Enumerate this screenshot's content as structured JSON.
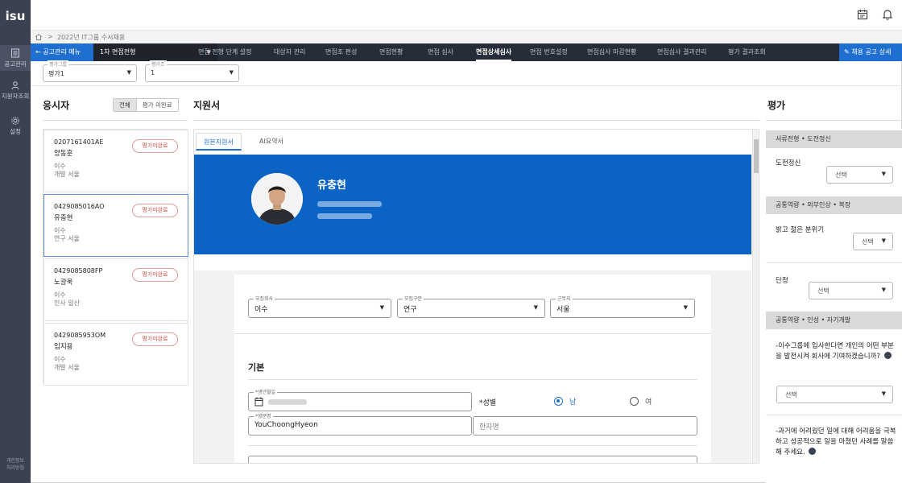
{
  "brand": {
    "logo": "isu"
  },
  "rail": {
    "items": [
      {
        "label": "공고관리",
        "icon": "document-icon"
      },
      {
        "label": "지원자조회",
        "icon": "person-icon"
      },
      {
        "label": "설정",
        "icon": "gear-icon"
      }
    ],
    "footer_line1": "개인정보",
    "footer_line2": "처리방침"
  },
  "breadcrumb": {
    "home_icon": "home-icon",
    "separator": ">",
    "current": "2022년 IT그룹 수시채용"
  },
  "nav": {
    "back_label": "← 공고관리 메뉴",
    "stage_select": "1차 면접전형",
    "tabs": [
      {
        "label": "면접 전형 단계 설정"
      },
      {
        "label": "대상자 관리"
      },
      {
        "label": "면접조 편성"
      },
      {
        "label": "면접현황"
      },
      {
        "label": "면접 심사"
      },
      {
        "label": "면접상세심사"
      },
      {
        "label": "면접 번호설정"
      },
      {
        "label": "면접심사 마감현황"
      },
      {
        "label": "면접심사 결과관리"
      },
      {
        "label": "평가 결과조회"
      }
    ],
    "active_tab": "면접상세심사",
    "cta_label": "채용 공고 상세"
  },
  "filters": [
    {
      "label": "평가그룹",
      "value": "평가1"
    },
    {
      "label": "평가조",
      "value": "1"
    }
  ],
  "applicants": {
    "title": "응시자",
    "seg_all": "전체",
    "seg_incomplete": "평가 미완료",
    "list": [
      {
        "id": "0207161401AE",
        "name": "양동훈",
        "company": "이수",
        "dept": "개발 서울",
        "status": "평가미완료"
      },
      {
        "id": "0429085016AO",
        "name": "유충현",
        "company": "이수",
        "dept": "연구 서울",
        "status": "평가미완료"
      },
      {
        "id": "0429085808FP",
        "name": "노광욱",
        "company": "이수",
        "dept": "인사 일산",
        "status": "평가미완료"
      },
      {
        "id": "0429085953OM",
        "name": "임지용",
        "company": "이수",
        "dept": "개발 서울",
        "status": "평가미완료"
      }
    ]
  },
  "application": {
    "title": "지원서",
    "tabs": [
      "원본지원서",
      "AI요약서"
    ],
    "profile_name": "유충현",
    "fields": {
      "company": {
        "label": "모집회사",
        "value": "이수"
      },
      "category": {
        "label": "모집구분",
        "value": "연구"
      },
      "location": {
        "label": "근무지",
        "value": "서울"
      }
    },
    "section_basic": "기본",
    "birth_label": "*생년월일",
    "gender_label": "*성별",
    "gender_male": "남",
    "gender_female": "여",
    "english_name_label": "*영문명",
    "english_name_value": "YouChoongHyeon",
    "hanja_placeholder": "한자명"
  },
  "evaluation": {
    "title": "평가",
    "sections": [
      {
        "header": "서류전형 • 도전정신",
        "items": [
          {
            "label": "도전정신",
            "value": "선택"
          }
        ]
      },
      {
        "header": "공통역량 • 외부인상 • 복장",
        "items": [
          {
            "label": "밝고 젊은 분위기",
            "value": "선택"
          },
          {
            "label": "단정",
            "value": "선택"
          }
        ]
      },
      {
        "header": "공통역량 • 인성 • 자기개발",
        "items": [
          {
            "label": "-이수그룹에 입사한다면 개인의 어떤 부분을 발전시켜 회사에 기여하겠습니까?",
            "value": "선택"
          },
          {
            "label": "-과거에 어려웠던 일에 대해 어려움을 극복하고 성공적으로 일을 마쳤던 사례를 말씀해 주세요.",
            "value": ""
          }
        ]
      }
    ]
  }
}
